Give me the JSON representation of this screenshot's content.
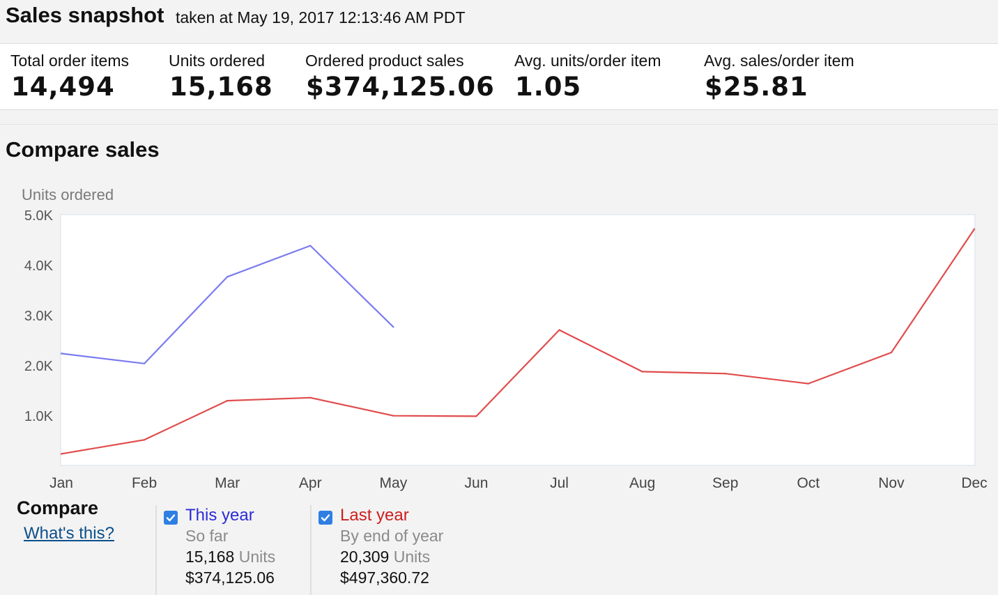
{
  "header": {
    "title": "Sales snapshot",
    "taken": "taken at May 19, 2017 12:13:46 AM PDT"
  },
  "metrics": [
    {
      "label": "Total order items",
      "value": "14,494"
    },
    {
      "label": "Units ordered",
      "value": "15,168"
    },
    {
      "label": "Ordered product sales",
      "value": "$374,125.06"
    },
    {
      "label": "Avg. units/order item",
      "value": "1.05"
    },
    {
      "label": "Avg. sales/order item",
      "value": "$25.81"
    }
  ],
  "compare": {
    "title": "Compare sales",
    "legend_title": "Compare",
    "whats_this": "What's this?",
    "series": [
      {
        "name": "This year",
        "subtitle": "So far",
        "units_value": "15,168",
        "units_word": "Units",
        "sales": "$374,125.06",
        "checked": true
      },
      {
        "name": "Last year",
        "subtitle": "By end of year",
        "units_value": "20,309",
        "units_word": "Units",
        "sales": "$497,360.72",
        "checked": true
      }
    ]
  },
  "chart_data": {
    "type": "line",
    "ylabel": "Units ordered",
    "categories": [
      "Jan",
      "Feb",
      "Mar",
      "Apr",
      "May",
      "Jun",
      "Jul",
      "Aug",
      "Sep",
      "Oct",
      "Nov",
      "Dec"
    ],
    "ylim": [
      0,
      5000
    ],
    "yticks": [
      1000,
      2000,
      3000,
      4000,
      5000
    ],
    "ytick_labels": [
      "1.0K",
      "2.0K",
      "3.0K",
      "4.0K",
      "5.0K"
    ],
    "grid": false,
    "series": [
      {
        "name": "This year",
        "color": "#7b7bf0",
        "values": [
          2230,
          2030,
          3760,
          4380,
          2760
        ]
      },
      {
        "name": "Last year",
        "color": "#e04c4c",
        "values": [
          230,
          510,
          1290,
          1350,
          990,
          980,
          2700,
          1870,
          1830,
          1630,
          2250,
          4710
        ]
      }
    ]
  },
  "colors": {
    "this_year": "#2b2bd6",
    "last_year": "#cc1f1f",
    "checkbox": "#2f7fe3",
    "link": "#0b4f8a"
  }
}
